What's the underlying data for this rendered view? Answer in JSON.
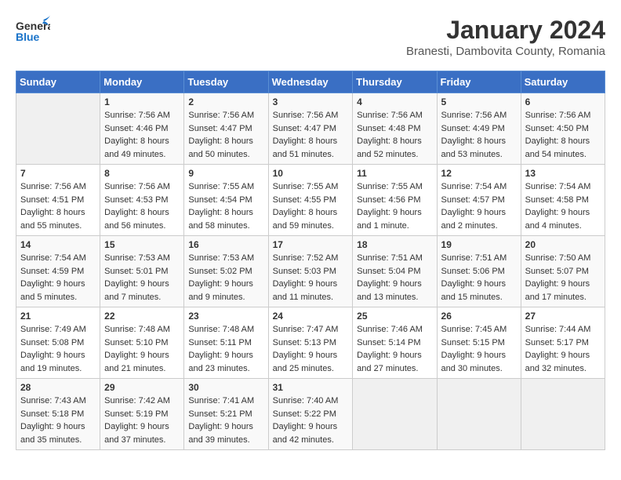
{
  "header": {
    "logo_line1": "General",
    "logo_line2": "Blue",
    "month": "January 2024",
    "location": "Branesti, Dambovita County, Romania"
  },
  "weekdays": [
    "Sunday",
    "Monday",
    "Tuesday",
    "Wednesday",
    "Thursday",
    "Friday",
    "Saturday"
  ],
  "weeks": [
    [
      {
        "day": "",
        "info": ""
      },
      {
        "day": "1",
        "info": "Sunrise: 7:56 AM\nSunset: 4:46 PM\nDaylight: 8 hours\nand 49 minutes."
      },
      {
        "day": "2",
        "info": "Sunrise: 7:56 AM\nSunset: 4:47 PM\nDaylight: 8 hours\nand 50 minutes."
      },
      {
        "day": "3",
        "info": "Sunrise: 7:56 AM\nSunset: 4:47 PM\nDaylight: 8 hours\nand 51 minutes."
      },
      {
        "day": "4",
        "info": "Sunrise: 7:56 AM\nSunset: 4:48 PM\nDaylight: 8 hours\nand 52 minutes."
      },
      {
        "day": "5",
        "info": "Sunrise: 7:56 AM\nSunset: 4:49 PM\nDaylight: 8 hours\nand 53 minutes."
      },
      {
        "day": "6",
        "info": "Sunrise: 7:56 AM\nSunset: 4:50 PM\nDaylight: 8 hours\nand 54 minutes."
      }
    ],
    [
      {
        "day": "7",
        "info": "Sunrise: 7:56 AM\nSunset: 4:51 PM\nDaylight: 8 hours\nand 55 minutes."
      },
      {
        "day": "8",
        "info": "Sunrise: 7:56 AM\nSunset: 4:53 PM\nDaylight: 8 hours\nand 56 minutes."
      },
      {
        "day": "9",
        "info": "Sunrise: 7:55 AM\nSunset: 4:54 PM\nDaylight: 8 hours\nand 58 minutes."
      },
      {
        "day": "10",
        "info": "Sunrise: 7:55 AM\nSunset: 4:55 PM\nDaylight: 8 hours\nand 59 minutes."
      },
      {
        "day": "11",
        "info": "Sunrise: 7:55 AM\nSunset: 4:56 PM\nDaylight: 9 hours\nand 1 minute."
      },
      {
        "day": "12",
        "info": "Sunrise: 7:54 AM\nSunset: 4:57 PM\nDaylight: 9 hours\nand 2 minutes."
      },
      {
        "day": "13",
        "info": "Sunrise: 7:54 AM\nSunset: 4:58 PM\nDaylight: 9 hours\nand 4 minutes."
      }
    ],
    [
      {
        "day": "14",
        "info": "Sunrise: 7:54 AM\nSunset: 4:59 PM\nDaylight: 9 hours\nand 5 minutes."
      },
      {
        "day": "15",
        "info": "Sunrise: 7:53 AM\nSunset: 5:01 PM\nDaylight: 9 hours\nand 7 minutes."
      },
      {
        "day": "16",
        "info": "Sunrise: 7:53 AM\nSunset: 5:02 PM\nDaylight: 9 hours\nand 9 minutes."
      },
      {
        "day": "17",
        "info": "Sunrise: 7:52 AM\nSunset: 5:03 PM\nDaylight: 9 hours\nand 11 minutes."
      },
      {
        "day": "18",
        "info": "Sunrise: 7:51 AM\nSunset: 5:04 PM\nDaylight: 9 hours\nand 13 minutes."
      },
      {
        "day": "19",
        "info": "Sunrise: 7:51 AM\nSunset: 5:06 PM\nDaylight: 9 hours\nand 15 minutes."
      },
      {
        "day": "20",
        "info": "Sunrise: 7:50 AM\nSunset: 5:07 PM\nDaylight: 9 hours\nand 17 minutes."
      }
    ],
    [
      {
        "day": "21",
        "info": "Sunrise: 7:49 AM\nSunset: 5:08 PM\nDaylight: 9 hours\nand 19 minutes."
      },
      {
        "day": "22",
        "info": "Sunrise: 7:48 AM\nSunset: 5:10 PM\nDaylight: 9 hours\nand 21 minutes."
      },
      {
        "day": "23",
        "info": "Sunrise: 7:48 AM\nSunset: 5:11 PM\nDaylight: 9 hours\nand 23 minutes."
      },
      {
        "day": "24",
        "info": "Sunrise: 7:47 AM\nSunset: 5:13 PM\nDaylight: 9 hours\nand 25 minutes."
      },
      {
        "day": "25",
        "info": "Sunrise: 7:46 AM\nSunset: 5:14 PM\nDaylight: 9 hours\nand 27 minutes."
      },
      {
        "day": "26",
        "info": "Sunrise: 7:45 AM\nSunset: 5:15 PM\nDaylight: 9 hours\nand 30 minutes."
      },
      {
        "day": "27",
        "info": "Sunrise: 7:44 AM\nSunset: 5:17 PM\nDaylight: 9 hours\nand 32 minutes."
      }
    ],
    [
      {
        "day": "28",
        "info": "Sunrise: 7:43 AM\nSunset: 5:18 PM\nDaylight: 9 hours\nand 35 minutes."
      },
      {
        "day": "29",
        "info": "Sunrise: 7:42 AM\nSunset: 5:19 PM\nDaylight: 9 hours\nand 37 minutes."
      },
      {
        "day": "30",
        "info": "Sunrise: 7:41 AM\nSunset: 5:21 PM\nDaylight: 9 hours\nand 39 minutes."
      },
      {
        "day": "31",
        "info": "Sunrise: 7:40 AM\nSunset: 5:22 PM\nDaylight: 9 hours\nand 42 minutes."
      },
      {
        "day": "",
        "info": ""
      },
      {
        "day": "",
        "info": ""
      },
      {
        "day": "",
        "info": ""
      }
    ]
  ]
}
